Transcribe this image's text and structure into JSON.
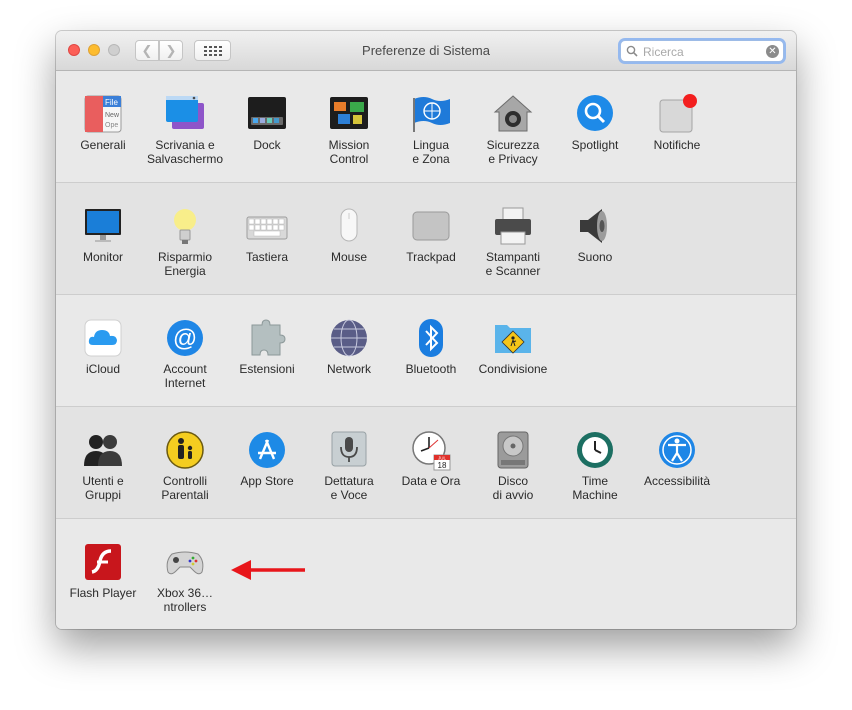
{
  "window": {
    "title": "Preferenze di Sistema"
  },
  "toolbar": {
    "back_icon": "chevron-left-icon",
    "forward_icon": "chevron-right-icon",
    "show_all_icon": "grid-icon"
  },
  "search": {
    "placeholder": "Ricerca",
    "value": ""
  },
  "sections": [
    {
      "items": [
        {
          "label": "Generali",
          "icon": "generali-icon"
        },
        {
          "label": "Scrivania e\nSalvaschermo",
          "icon": "desktop-screensaver-icon"
        },
        {
          "label": "Dock",
          "icon": "dock-icon"
        },
        {
          "label": "Mission\nControl",
          "icon": "mission-control-icon"
        },
        {
          "label": "Lingua\ne Zona",
          "icon": "language-flag-icon"
        },
        {
          "label": "Sicurezza\ne Privacy",
          "icon": "security-house-icon"
        },
        {
          "label": "Spotlight",
          "icon": "spotlight-icon"
        },
        {
          "label": "Notifiche",
          "icon": "notifications-icon"
        }
      ]
    },
    {
      "items": [
        {
          "label": "Monitor",
          "icon": "monitor-icon"
        },
        {
          "label": "Risparmio\nEnergia",
          "icon": "lightbulb-icon"
        },
        {
          "label": "Tastiera",
          "icon": "keyboard-icon"
        },
        {
          "label": "Mouse",
          "icon": "mouse-icon"
        },
        {
          "label": "Trackpad",
          "icon": "trackpad-icon"
        },
        {
          "label": "Stampanti\ne Scanner",
          "icon": "printer-icon"
        },
        {
          "label": "Suono",
          "icon": "speaker-icon"
        }
      ]
    },
    {
      "items": [
        {
          "label": "iCloud",
          "icon": "icloud-icon"
        },
        {
          "label": "Account\nInternet",
          "icon": "at-sign-icon"
        },
        {
          "label": "Estensioni",
          "icon": "puzzle-icon"
        },
        {
          "label": "Network",
          "icon": "globe-network-icon"
        },
        {
          "label": "Bluetooth",
          "icon": "bluetooth-icon"
        },
        {
          "label": "Condivisione",
          "icon": "sharing-folder-icon"
        }
      ]
    },
    {
      "items": [
        {
          "label": "Utenti e\nGruppi",
          "icon": "users-icon"
        },
        {
          "label": "Controlli\nParentali",
          "icon": "parental-controls-icon"
        },
        {
          "label": "App Store",
          "icon": "app-store-icon"
        },
        {
          "label": "Dettatura\ne Voce",
          "icon": "microphone-icon"
        },
        {
          "label": "Data e Ora",
          "icon": "clock-calendar-icon"
        },
        {
          "label": "Disco\ndi avvio",
          "icon": "disk-icon"
        },
        {
          "label": "Time\nMachine",
          "icon": "time-machine-icon"
        },
        {
          "label": "Accessibilità",
          "icon": "accessibility-icon"
        }
      ]
    },
    {
      "items": [
        {
          "label": "Flash Player",
          "icon": "flash-player-icon"
        },
        {
          "label": "Xbox 36…ntrollers",
          "icon": "gamepad-icon"
        }
      ]
    }
  ],
  "annotation": {
    "icon": "red-arrow-icon",
    "color": "#e8161b"
  },
  "calendar_icon": {
    "month": "JUL",
    "day": "18"
  }
}
